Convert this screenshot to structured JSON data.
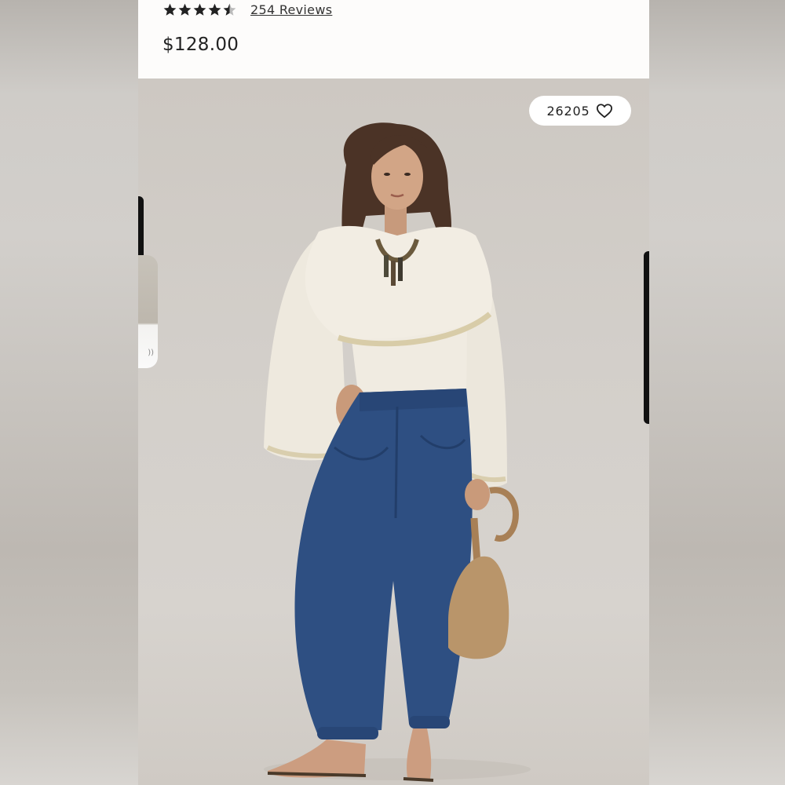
{
  "product": {
    "rating": 4.5,
    "reviews_label": "254 Reviews",
    "price": "$128.00"
  },
  "image": {
    "like_count": "26205",
    "like_icon": "heart-outline-icon",
    "subject": "model-photo"
  },
  "colors": {
    "page_bg": "#fdfcfb",
    "photo_bg": "#d3cfca",
    "text": "#222222",
    "denim": "#2f4f80",
    "blouse": "#efeadf",
    "bag": "#b9956a"
  }
}
